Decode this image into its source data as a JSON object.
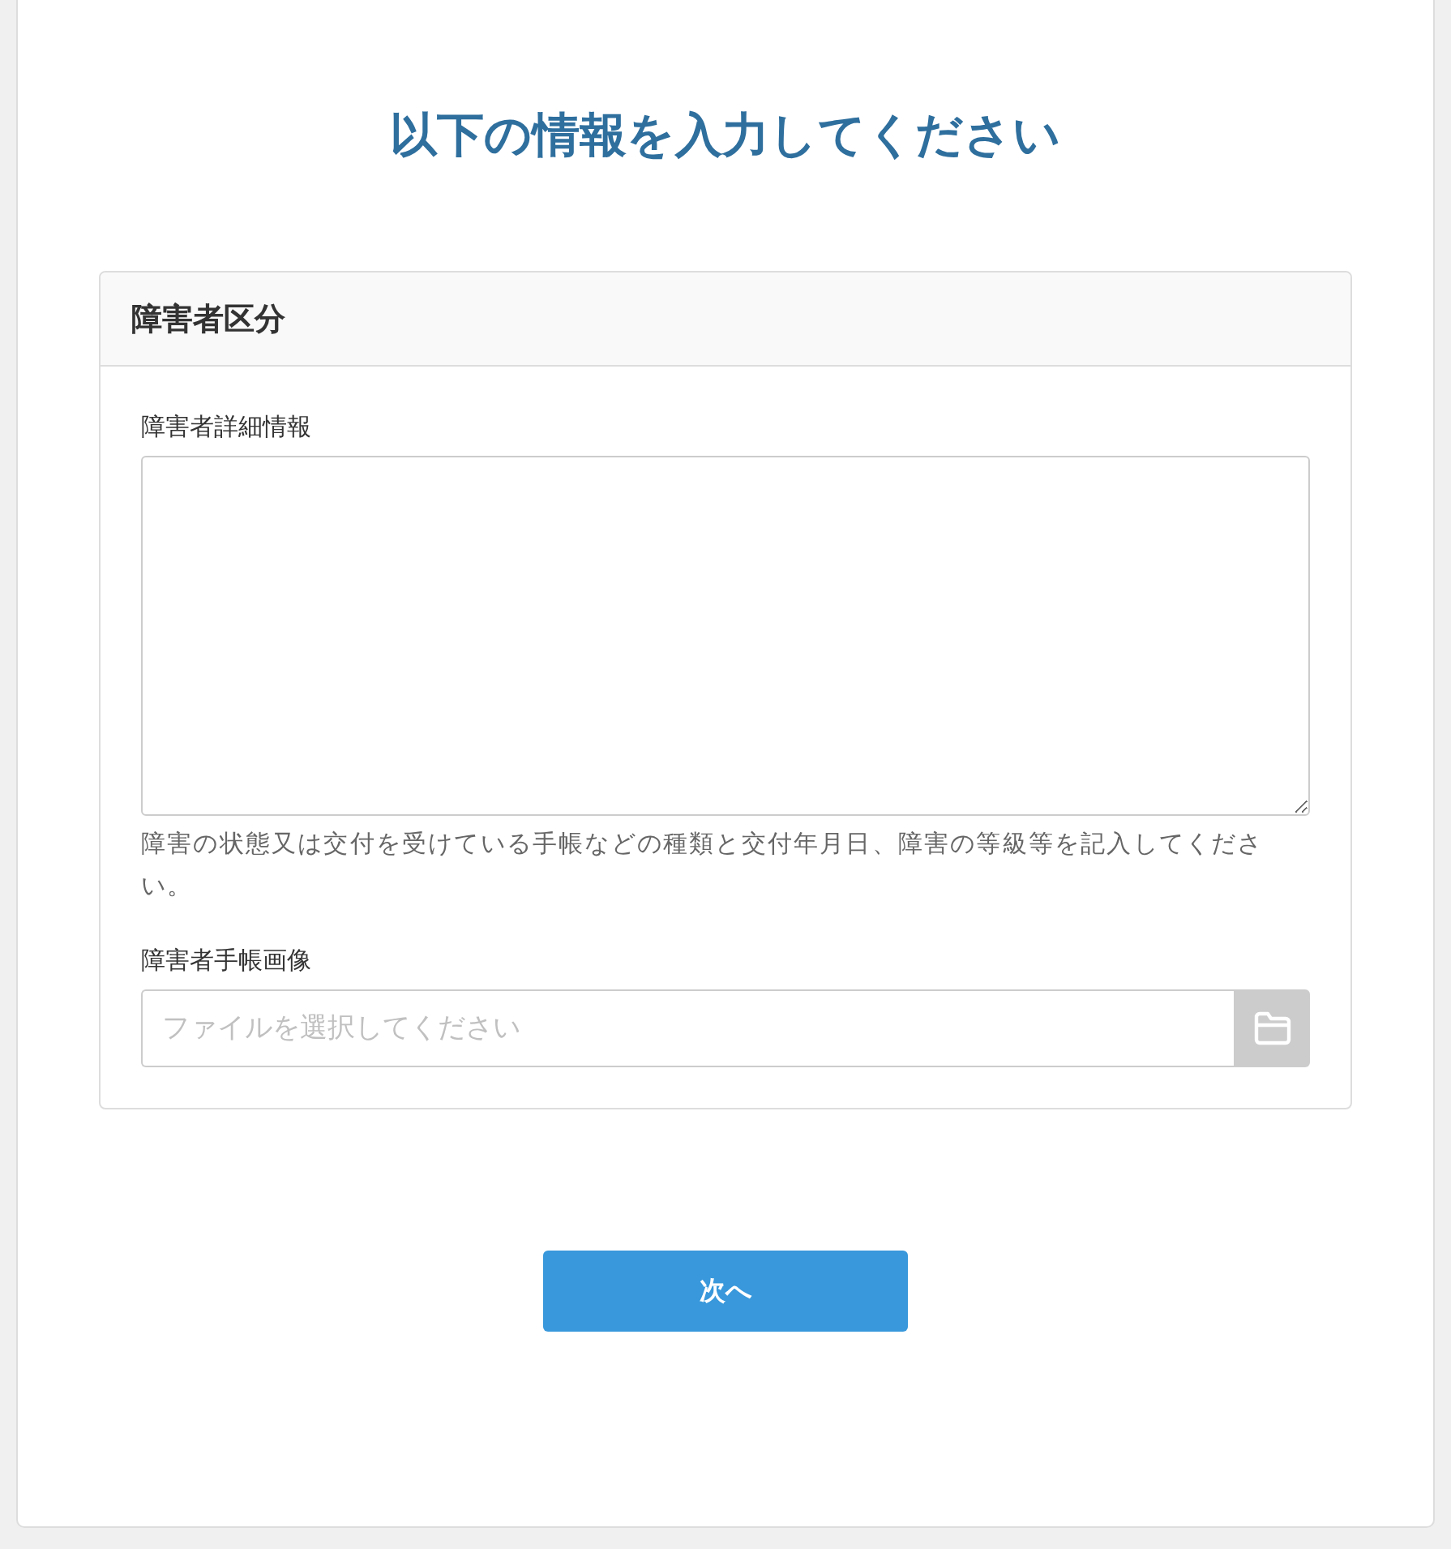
{
  "title": "以下の情報を入力してください",
  "section": {
    "heading": "障害者区分",
    "details": {
      "label": "障害者詳細情報",
      "help": "障害の状態又は交付を受けている手帳などの種類と交付年月日、障害の等級等を記入してください。"
    },
    "file": {
      "label": "障害者手帳画像",
      "placeholder": "ファイルを選択してください"
    }
  },
  "next_button": "次へ"
}
